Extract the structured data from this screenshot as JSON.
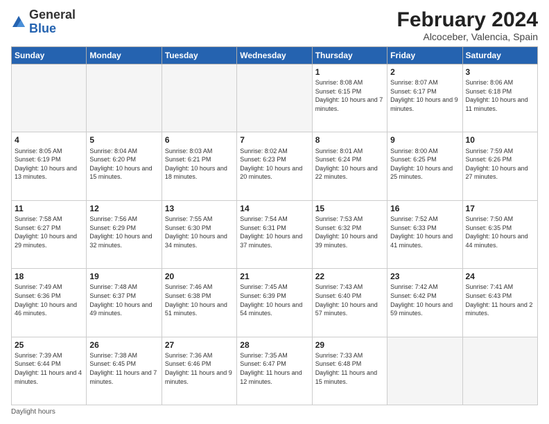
{
  "logo": {
    "general": "General",
    "blue": "Blue"
  },
  "header": {
    "month_title": "February 2024",
    "subtitle": "Alcoceber, Valencia, Spain"
  },
  "weekdays": [
    "Sunday",
    "Monday",
    "Tuesday",
    "Wednesday",
    "Thursday",
    "Friday",
    "Saturday"
  ],
  "footer": {
    "label": "Daylight hours"
  },
  "weeks": [
    [
      {
        "day": "",
        "info": ""
      },
      {
        "day": "",
        "info": ""
      },
      {
        "day": "",
        "info": ""
      },
      {
        "day": "",
        "info": ""
      },
      {
        "day": "1",
        "info": "Sunrise: 8:08 AM\nSunset: 6:15 PM\nDaylight: 10 hours\nand 7 minutes."
      },
      {
        "day": "2",
        "info": "Sunrise: 8:07 AM\nSunset: 6:17 PM\nDaylight: 10 hours\nand 9 minutes."
      },
      {
        "day": "3",
        "info": "Sunrise: 8:06 AM\nSunset: 6:18 PM\nDaylight: 10 hours\nand 11 minutes."
      }
    ],
    [
      {
        "day": "4",
        "info": "Sunrise: 8:05 AM\nSunset: 6:19 PM\nDaylight: 10 hours\nand 13 minutes."
      },
      {
        "day": "5",
        "info": "Sunrise: 8:04 AM\nSunset: 6:20 PM\nDaylight: 10 hours\nand 15 minutes."
      },
      {
        "day": "6",
        "info": "Sunrise: 8:03 AM\nSunset: 6:21 PM\nDaylight: 10 hours\nand 18 minutes."
      },
      {
        "day": "7",
        "info": "Sunrise: 8:02 AM\nSunset: 6:23 PM\nDaylight: 10 hours\nand 20 minutes."
      },
      {
        "day": "8",
        "info": "Sunrise: 8:01 AM\nSunset: 6:24 PM\nDaylight: 10 hours\nand 22 minutes."
      },
      {
        "day": "9",
        "info": "Sunrise: 8:00 AM\nSunset: 6:25 PM\nDaylight: 10 hours\nand 25 minutes."
      },
      {
        "day": "10",
        "info": "Sunrise: 7:59 AM\nSunset: 6:26 PM\nDaylight: 10 hours\nand 27 minutes."
      }
    ],
    [
      {
        "day": "11",
        "info": "Sunrise: 7:58 AM\nSunset: 6:27 PM\nDaylight: 10 hours\nand 29 minutes."
      },
      {
        "day": "12",
        "info": "Sunrise: 7:56 AM\nSunset: 6:29 PM\nDaylight: 10 hours\nand 32 minutes."
      },
      {
        "day": "13",
        "info": "Sunrise: 7:55 AM\nSunset: 6:30 PM\nDaylight: 10 hours\nand 34 minutes."
      },
      {
        "day": "14",
        "info": "Sunrise: 7:54 AM\nSunset: 6:31 PM\nDaylight: 10 hours\nand 37 minutes."
      },
      {
        "day": "15",
        "info": "Sunrise: 7:53 AM\nSunset: 6:32 PM\nDaylight: 10 hours\nand 39 minutes."
      },
      {
        "day": "16",
        "info": "Sunrise: 7:52 AM\nSunset: 6:33 PM\nDaylight: 10 hours\nand 41 minutes."
      },
      {
        "day": "17",
        "info": "Sunrise: 7:50 AM\nSunset: 6:35 PM\nDaylight: 10 hours\nand 44 minutes."
      }
    ],
    [
      {
        "day": "18",
        "info": "Sunrise: 7:49 AM\nSunset: 6:36 PM\nDaylight: 10 hours\nand 46 minutes."
      },
      {
        "day": "19",
        "info": "Sunrise: 7:48 AM\nSunset: 6:37 PM\nDaylight: 10 hours\nand 49 minutes."
      },
      {
        "day": "20",
        "info": "Sunrise: 7:46 AM\nSunset: 6:38 PM\nDaylight: 10 hours\nand 51 minutes."
      },
      {
        "day": "21",
        "info": "Sunrise: 7:45 AM\nSunset: 6:39 PM\nDaylight: 10 hours\nand 54 minutes."
      },
      {
        "day": "22",
        "info": "Sunrise: 7:43 AM\nSunset: 6:40 PM\nDaylight: 10 hours\nand 57 minutes."
      },
      {
        "day": "23",
        "info": "Sunrise: 7:42 AM\nSunset: 6:42 PM\nDaylight: 10 hours\nand 59 minutes."
      },
      {
        "day": "24",
        "info": "Sunrise: 7:41 AM\nSunset: 6:43 PM\nDaylight: 11 hours\nand 2 minutes."
      }
    ],
    [
      {
        "day": "25",
        "info": "Sunrise: 7:39 AM\nSunset: 6:44 PM\nDaylight: 11 hours\nand 4 minutes."
      },
      {
        "day": "26",
        "info": "Sunrise: 7:38 AM\nSunset: 6:45 PM\nDaylight: 11 hours\nand 7 minutes."
      },
      {
        "day": "27",
        "info": "Sunrise: 7:36 AM\nSunset: 6:46 PM\nDaylight: 11 hours\nand 9 minutes."
      },
      {
        "day": "28",
        "info": "Sunrise: 7:35 AM\nSunset: 6:47 PM\nDaylight: 11 hours\nand 12 minutes."
      },
      {
        "day": "29",
        "info": "Sunrise: 7:33 AM\nSunset: 6:48 PM\nDaylight: 11 hours\nand 15 minutes."
      },
      {
        "day": "",
        "info": ""
      },
      {
        "day": "",
        "info": ""
      }
    ]
  ]
}
